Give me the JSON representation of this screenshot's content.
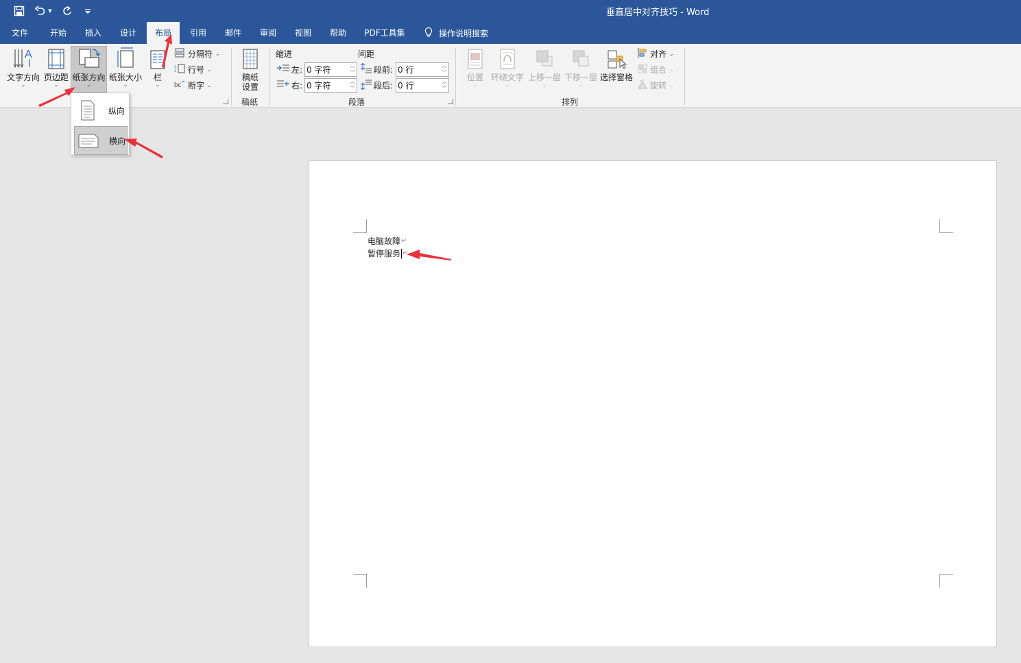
{
  "window": {
    "title": "垂直居中对齐技巧  -  Word"
  },
  "qat": {
    "save_icon": "save-icon",
    "undo_icon": "undo-icon",
    "redo_icon": "redo-icon",
    "customize_icon": "customize-icon"
  },
  "tabs": [
    {
      "label": "文件"
    },
    {
      "label": "开始"
    },
    {
      "label": "插入"
    },
    {
      "label": "设计"
    },
    {
      "label": "布局",
      "active": true
    },
    {
      "label": "引用"
    },
    {
      "label": "邮件"
    },
    {
      "label": "审阅"
    },
    {
      "label": "视图"
    },
    {
      "label": "帮助"
    },
    {
      "label": "PDF工具集"
    }
  ],
  "tell_me": {
    "label": "操作说明搜索"
  },
  "ribbon": {
    "page_setup": {
      "text_direction": "文字方向",
      "margins": "页边距",
      "orientation": "纸张方向",
      "size": "纸张大小",
      "columns": "栏",
      "breaks": "分隔符",
      "line_numbers": "行号",
      "hyphenation": "断字"
    },
    "draft": {
      "button_line1": "稿纸",
      "button_line2": "设置",
      "group_label": "稿纸"
    },
    "paragraph": {
      "indent_label": "缩进",
      "spacing_label": "间距",
      "left_label": "左:",
      "right_label": "右:",
      "before_label": "段前:",
      "after_label": "段后:",
      "left_value": "0 字符",
      "right_value": "0 字符",
      "before_value": "0 行",
      "after_value": "0 行",
      "group_label": "段落"
    },
    "arrange": {
      "position": "位置",
      "wrap_text": "环绕文字",
      "bring_forward": "上移一层",
      "send_backward": "下移一层",
      "selection_pane": "选择窗格",
      "align": "对齐",
      "group": "组合",
      "rotate": "旋转",
      "group_label": "排列"
    }
  },
  "orientation_menu": {
    "portrait": "纵向",
    "landscape": "横向",
    "selected": "横向"
  },
  "document": {
    "lines": [
      "电脑故障",
      "暂停服务"
    ]
  },
  "colors": {
    "title_bar": "#2b579a",
    "ribbon_bg": "#f3f3f3",
    "workspace_bg": "#e6e6e6",
    "annotation_arrow": "#e8323c"
  }
}
